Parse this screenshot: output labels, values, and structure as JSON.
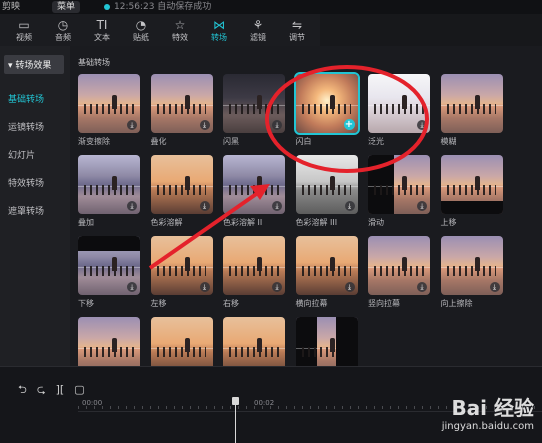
{
  "titlebar": {
    "app_name": "剪映",
    "menu_label": "菜单",
    "status": "12:56:23 自动保存成功"
  },
  "toolbar": {
    "tools": [
      {
        "label": "视频",
        "icon": "▭"
      },
      {
        "label": "音频",
        "icon": "◷"
      },
      {
        "label": "文本",
        "icon": "TI"
      },
      {
        "label": "贴纸",
        "icon": "◔"
      },
      {
        "label": "特效",
        "icon": "☆"
      },
      {
        "label": "转场",
        "icon": "⋈"
      },
      {
        "label": "滤镜",
        "icon": "⚘"
      },
      {
        "label": "调节",
        "icon": "⇋"
      }
    ],
    "active_index": 5
  },
  "sidebar": {
    "header": "▾ 转场效果",
    "items": [
      "基础转场",
      "运镜转场",
      "幻灯片",
      "特效转场",
      "遮罩转场"
    ],
    "selected_index": 0
  },
  "panel": {
    "section_title": "基础转场",
    "tiles": [
      {
        "label": "渐变擦除",
        "style": "sunset",
        "badge": "download"
      },
      {
        "label": "叠化",
        "style": "sunset",
        "badge": "download"
      },
      {
        "label": "闪黑",
        "style": "dark",
        "badge": "download"
      },
      {
        "label": "闪白",
        "style": "glow",
        "badge": "add",
        "selected": true
      },
      {
        "label": "泛光",
        "style": "bright",
        "badge": "download"
      },
      {
        "label": "模糊",
        "style": "sunset",
        "badge": "none"
      },
      {
        "label": "叠加",
        "style": "cool",
        "badge": "download"
      },
      {
        "label": "色彩溶解",
        "style": "orange",
        "badge": "download"
      },
      {
        "label": "色彩溶解 II",
        "style": "cool",
        "badge": "download"
      },
      {
        "label": "色彩溶解 III",
        "style": "mono",
        "badge": "download"
      },
      {
        "label": "滑动",
        "style": "sunset split",
        "badge": "download"
      },
      {
        "label": "上移",
        "style": "sunset bot",
        "badge": "download"
      },
      {
        "label": "下移",
        "style": "cool top",
        "badge": "download"
      },
      {
        "label": "左移",
        "style": "orange",
        "badge": "download"
      },
      {
        "label": "右移",
        "style": "orange",
        "badge": "download"
      },
      {
        "label": "横向拉幕",
        "style": "orange",
        "badge": "download"
      },
      {
        "label": "竖向拉幕",
        "style": "sunset",
        "badge": "download"
      },
      {
        "label": "向上擦除",
        "style": "sunset",
        "badge": "download"
      },
      {
        "label": "",
        "style": "sunset",
        "badge": "none"
      },
      {
        "label": "",
        "style": "orange",
        "badge": "none"
      },
      {
        "label": "",
        "style": "orange",
        "badge": "none"
      },
      {
        "label": "",
        "style": "sunset strip",
        "badge": "download"
      }
    ]
  },
  "timeline": {
    "controls": [
      "⮌",
      "⮎",
      "][",
      "▢"
    ],
    "ticks": [
      "00:00",
      "00:02"
    ]
  },
  "watermark": {
    "line1": "Bai 经验",
    "line2": "jingyan.baidu.com"
  }
}
